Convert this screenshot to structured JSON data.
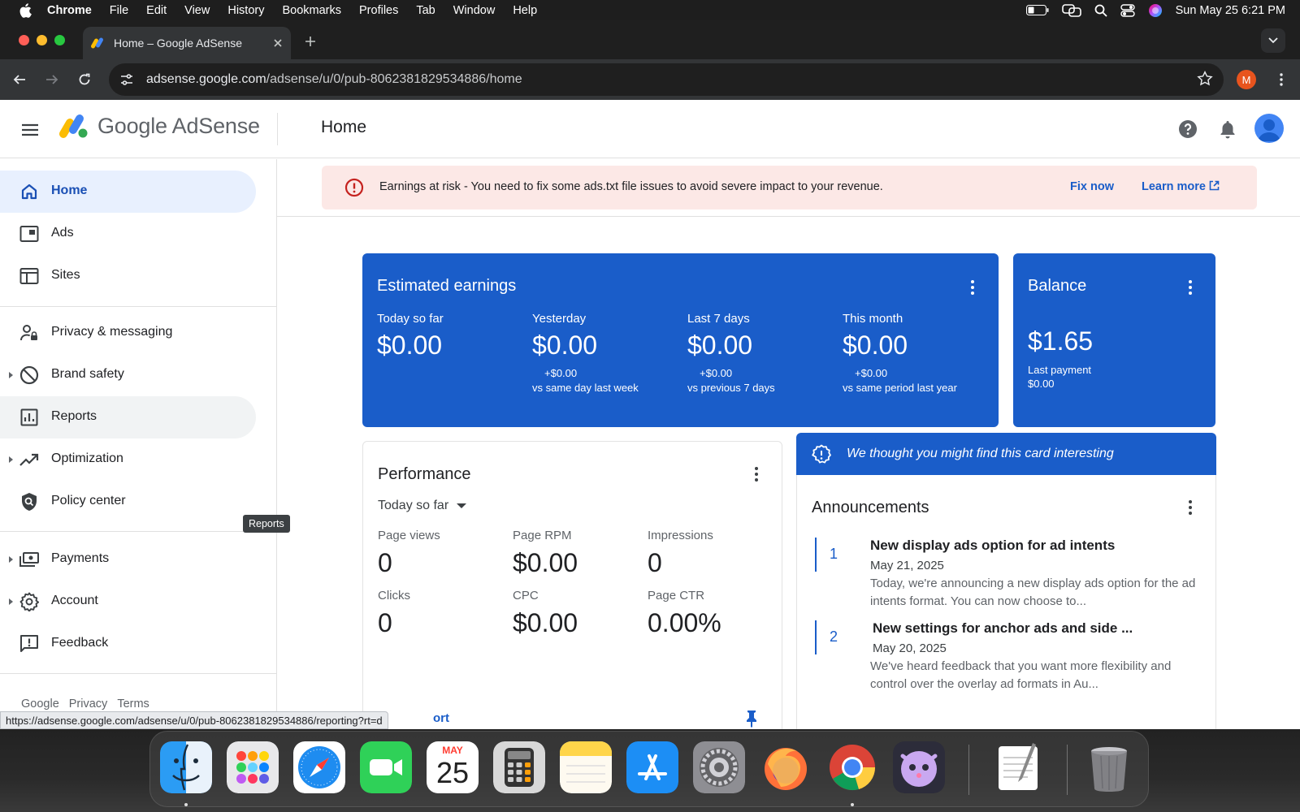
{
  "menubar": {
    "app": "Chrome",
    "items": [
      "File",
      "Edit",
      "View",
      "History",
      "Bookmarks",
      "Profiles",
      "Tab",
      "Window",
      "Help"
    ],
    "clock": "Sun May 25  6:21 PM"
  },
  "browser": {
    "tab_title": "Home – Google AdSense",
    "url_host": "adsense.google.com",
    "url_path": "/adsense/u/0/pub-8062381829534886/home",
    "profile_initial": "M",
    "status_url": "https://adsense.google.com/adsense/u/0/pub-8062381829534886/reporting?rt=d"
  },
  "header": {
    "brand": "Google AdSense",
    "page_title": "Home"
  },
  "sidebar": {
    "items": [
      {
        "label": "Home",
        "icon": "home-icon"
      },
      {
        "label": "Ads",
        "icon": "ads-icon"
      },
      {
        "label": "Sites",
        "icon": "sites-icon"
      },
      {
        "label": "Privacy & messaging",
        "icon": "privacy-icon"
      },
      {
        "label": "Brand safety",
        "icon": "block-icon"
      },
      {
        "label": "Reports",
        "icon": "reports-icon"
      },
      {
        "label": "Optimization",
        "icon": "trending-icon"
      },
      {
        "label": "Policy center",
        "icon": "policy-icon"
      },
      {
        "label": "Payments",
        "icon": "payments-icon"
      },
      {
        "label": "Account",
        "icon": "gear-icon"
      },
      {
        "label": "Feedback",
        "icon": "feedback-icon"
      }
    ],
    "footer_links": [
      "Google",
      "Privacy",
      "Terms"
    ],
    "tooltip": "Reports"
  },
  "banner": {
    "message": "Earnings at risk - You need to fix some ads.txt file issues to avoid severe impact to your revenue.",
    "fix_label": "Fix now",
    "learn_label": "Learn more"
  },
  "earnings": {
    "title": "Estimated earnings",
    "metrics": [
      {
        "label": "Today so far",
        "value": "$0.00",
        "delta": "",
        "comparison": ""
      },
      {
        "label": "Yesterday",
        "value": "$0.00",
        "delta": "+$0.00",
        "comparison": "vs same day last week"
      },
      {
        "label": "Last 7 days",
        "value": "$0.00",
        "delta": "+$0.00",
        "comparison": "vs previous 7 days"
      },
      {
        "label": "This month",
        "value": "$0.00",
        "delta": "+$0.00",
        "comparison": "vs same period last year"
      }
    ]
  },
  "balance": {
    "title": "Balance",
    "value": "$1.65",
    "last_payment_label": "Last payment",
    "last_payment_value": "$0.00"
  },
  "performance": {
    "title": "Performance",
    "range": "Today so far",
    "metrics": [
      {
        "label": "Page views",
        "value": "0"
      },
      {
        "label": "Page RPM",
        "value": "$0.00"
      },
      {
        "label": "Impressions",
        "value": "0"
      },
      {
        "label": "Clicks",
        "value": "0"
      },
      {
        "label": "CPC",
        "value": "$0.00"
      },
      {
        "label": "Page CTR",
        "value": "0.00%"
      }
    ],
    "link_partial": "ort"
  },
  "suggestion": {
    "text": "We thought you might find this card interesting"
  },
  "announcements": {
    "title": "Announcements",
    "items": [
      {
        "num": "1",
        "title": "New display ads option for ad intents",
        "date": "May 21, 2025",
        "body": "Today, we're announcing a new display ads option for the ad intents format. You can now choose to..."
      },
      {
        "num": "2",
        "title": "New settings for anchor ads and side ...",
        "date": "May 20, 2025",
        "body": "We've heard feedback that you want more flexibility and control over the overlay ad formats in Au..."
      }
    ]
  },
  "dock": {
    "calendar_month": "MAY",
    "calendar_day": "25"
  }
}
